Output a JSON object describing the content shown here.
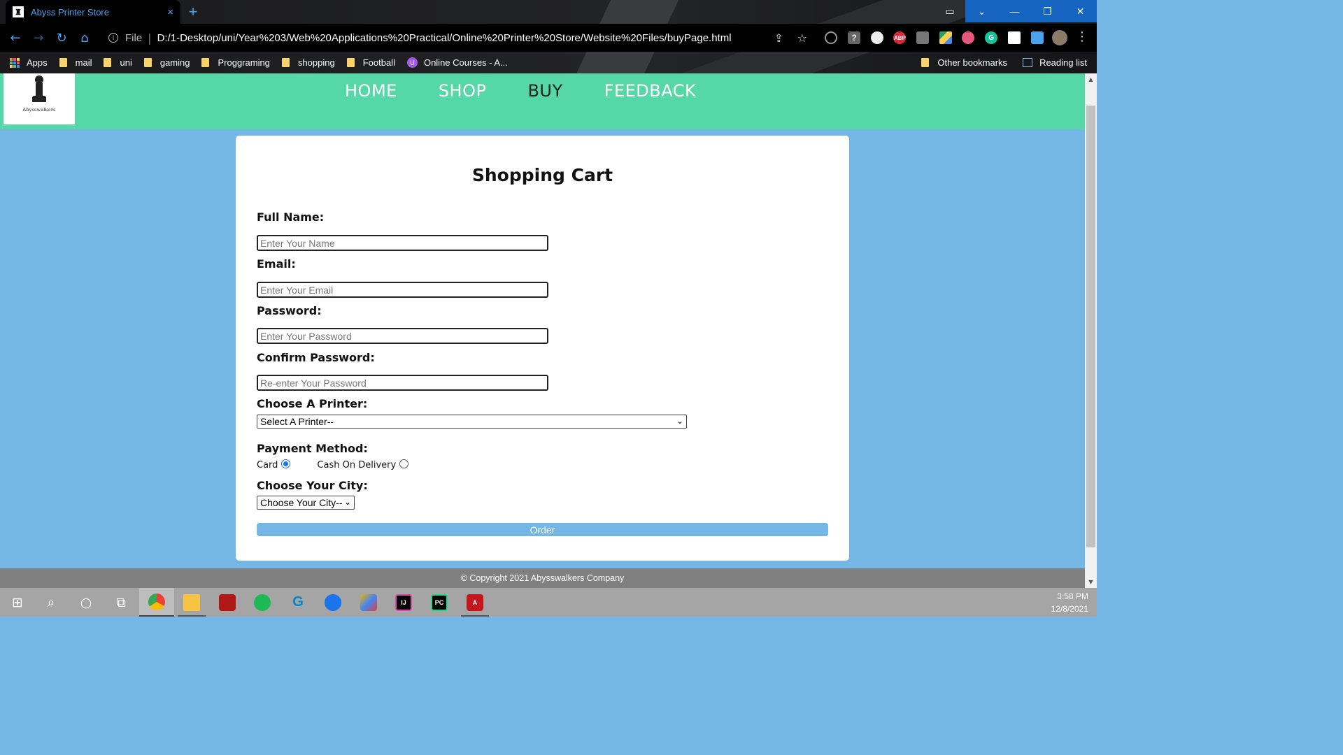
{
  "browser": {
    "tab_title": "Abyss Printer Store",
    "tab_close": "×",
    "new_tab": "+",
    "scheme_label": "File",
    "url": "D:/1-Desktop/uni/Year%203/Web%20Applications%20Practical/Online%20Printer%20Store/Website%20Files/buyPage.html",
    "bookmarks": [
      "Apps",
      "mail",
      "uni",
      "gaming",
      "Proggraming",
      "shopping",
      "Football",
      "Online Courses - A..."
    ],
    "bookmarks_right": [
      "Other bookmarks",
      "Reading list"
    ]
  },
  "site": {
    "logo_text": "Abysswalkers",
    "nav": [
      "HOME",
      "SHOP",
      "BUY",
      "FEEDBACK"
    ],
    "active_nav": "BUY"
  },
  "form": {
    "title": "Shopping Cart",
    "full_name_label": "Full Name:",
    "full_name_placeholder": "Enter Your Name",
    "email_label": "Email:",
    "email_placeholder": "Enter Your Email",
    "password_label": "Password:",
    "password_placeholder": "Enter Your Password",
    "confirm_label": "Confirm Password:",
    "confirm_placeholder": "Re-enter Your Password",
    "printer_label": "Choose A Printer:",
    "printer_selected": "Select A Printer--",
    "payment_label": "Payment Method:",
    "payment_options": [
      "Card",
      "Cash On Delivery"
    ],
    "payment_selected": "Card",
    "city_label": "Choose Your City:",
    "city_selected": "Choose Your City--",
    "order_button": "Order"
  },
  "footer": {
    "copyright": "© Copyright 2021 Abysswalkers Company"
  },
  "taskbar": {
    "time": "3:58 PM",
    "date": "12/8/2021"
  }
}
